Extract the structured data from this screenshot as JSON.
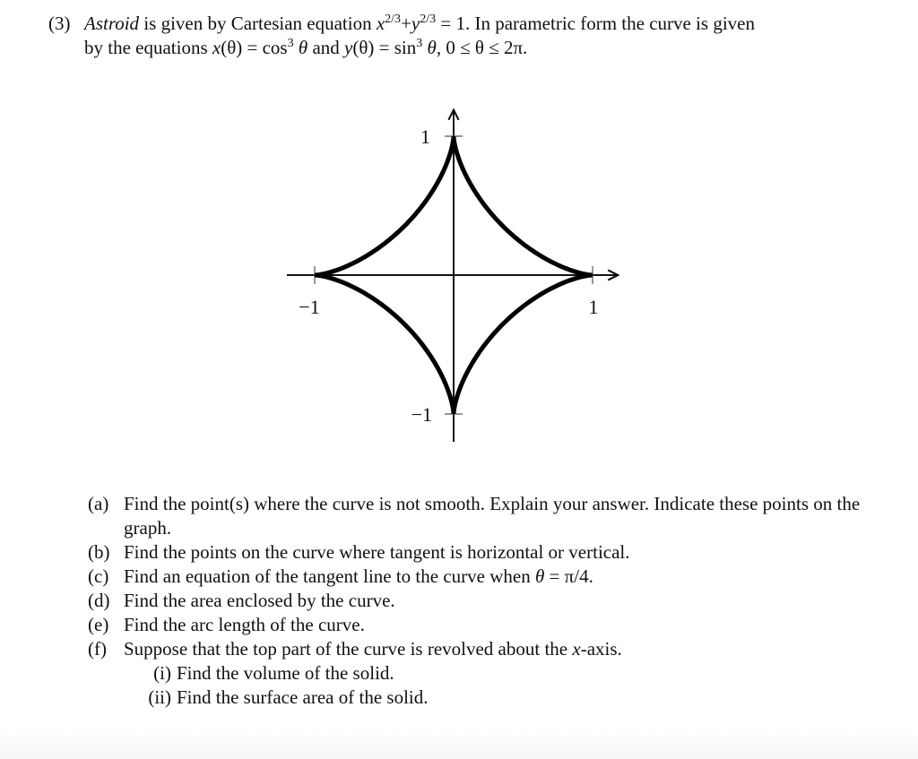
{
  "problem": {
    "number": "(3)",
    "line1_term": "Astroid",
    "line1_a": " is given by Cartesian equation ",
    "line1_eq": "x",
    "line1_exp1": "2/3",
    "line1_plus": "+",
    "line1_y": "y",
    "line1_exp2": "2/3",
    "line1_b": " = 1. In parametric form the curve is given",
    "line2_a": "by the equations ",
    "line2_x": "x",
    "line2_b": "(θ) = cos",
    "line2_exp1": "3",
    "line2_theta1": " θ",
    "line2_c": " and ",
    "line2_y": "y",
    "line2_d": "(θ) = sin",
    "line2_exp2": "3",
    "line2_theta2": " θ",
    "line2_e": ", 0 ≤ θ ≤ 2π."
  },
  "chart_data": {
    "type": "line",
    "title": "",
    "xlabel": "",
    "ylabel": "",
    "equation": "x = cos^3(θ), y = sin^3(θ), 0 ≤ θ ≤ 2π",
    "xlim": [
      -1.25,
      1.25
    ],
    "ylim": [
      -1.25,
      1.25
    ],
    "x_ticks": [
      -1,
      1
    ],
    "y_ticks": [
      -1,
      1
    ],
    "x_tick_labels": [
      "−1",
      "1"
    ],
    "y_tick_labels": [
      "−1",
      "1"
    ],
    "grid": false,
    "series": [
      {
        "name": "astroid",
        "theta_range": [
          0,
          6.2832
        ],
        "samples": 400
      }
    ]
  },
  "parts": [
    {
      "label": "(a)",
      "text": "Find the point(s) where the curve is not smooth. Explain your answer. Indicate these points on the graph."
    },
    {
      "label": "(b)",
      "text": "Find the points on the curve where tangent is horizontal or vertical."
    },
    {
      "label": "(c)",
      "text_a": "Find an equation of the tangent line to the curve when ",
      "text_var": "θ",
      "text_b": " = π/4."
    },
    {
      "label": "(d)",
      "text": "Find the area enclosed by the curve."
    },
    {
      "label": "(e)",
      "text": "Find the arc length of the curve."
    },
    {
      "label": "(f)",
      "text_a": "Suppose that the top part of the curve is revolved about the ",
      "text_var": "x",
      "text_b": "-axis."
    }
  ],
  "subparts": [
    {
      "label": "(i)",
      "text": "Find the volume of the solid."
    },
    {
      "label": "(ii)",
      "text": "Find the surface area of the solid."
    }
  ]
}
